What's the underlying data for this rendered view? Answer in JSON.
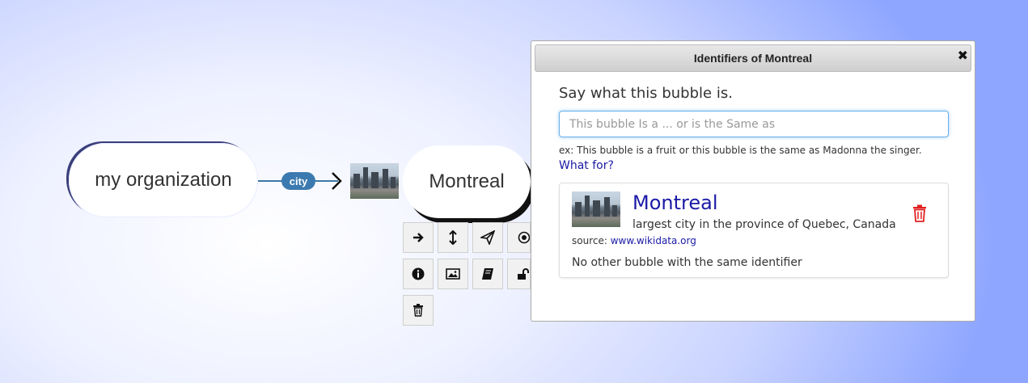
{
  "graph": {
    "center_bubble": "my organization",
    "relation_label": "city",
    "target_bubble": "Montreal"
  },
  "toolbar": {
    "buttons": [
      {
        "name": "add-child-button",
        "icon": "arrow-right-icon",
        "glyph": "➜"
      },
      {
        "name": "move-button",
        "icon": "vertical-arrows-icon",
        "glyph": "↕"
      },
      {
        "name": "share-button",
        "icon": "paper-plane-icon",
        "glyph": "➢"
      },
      {
        "name": "focus-button",
        "icon": "target-icon",
        "glyph": "◎"
      },
      {
        "name": "info-button",
        "icon": "info-icon",
        "glyph": "ℹ"
      },
      {
        "name": "image-button",
        "icon": "image-icon",
        "glyph": "▨"
      },
      {
        "name": "book-button",
        "icon": "book-icon",
        "glyph": "▤"
      },
      {
        "name": "lock-button",
        "icon": "unlock-icon",
        "glyph": "🔓"
      },
      {
        "name": "delete-button",
        "icon": "trash-icon",
        "glyph": "🗑"
      }
    ]
  },
  "dialog": {
    "title": "Identifiers of Montreal",
    "close_glyph": "✖",
    "prompt": "Say what this bubble is.",
    "input_placeholder": "This bubble Is a ... or is the Same as",
    "input_value": "",
    "example": "ex: This bubble is a fruit or this bubble is the same as Madonna the singer.",
    "what_for": "What for?",
    "identifier": {
      "title": "Montreal",
      "description": "largest city in the province of Quebec, Canada",
      "source_label": "source:",
      "source_link": "www.wikidata.org",
      "note": "No other bubble with the same identifier"
    }
  },
  "colors": {
    "relation_pill": "#3b7ab0",
    "link": "#1a1aa6",
    "delete": "#e02020",
    "input_focus": "#66afe9"
  }
}
